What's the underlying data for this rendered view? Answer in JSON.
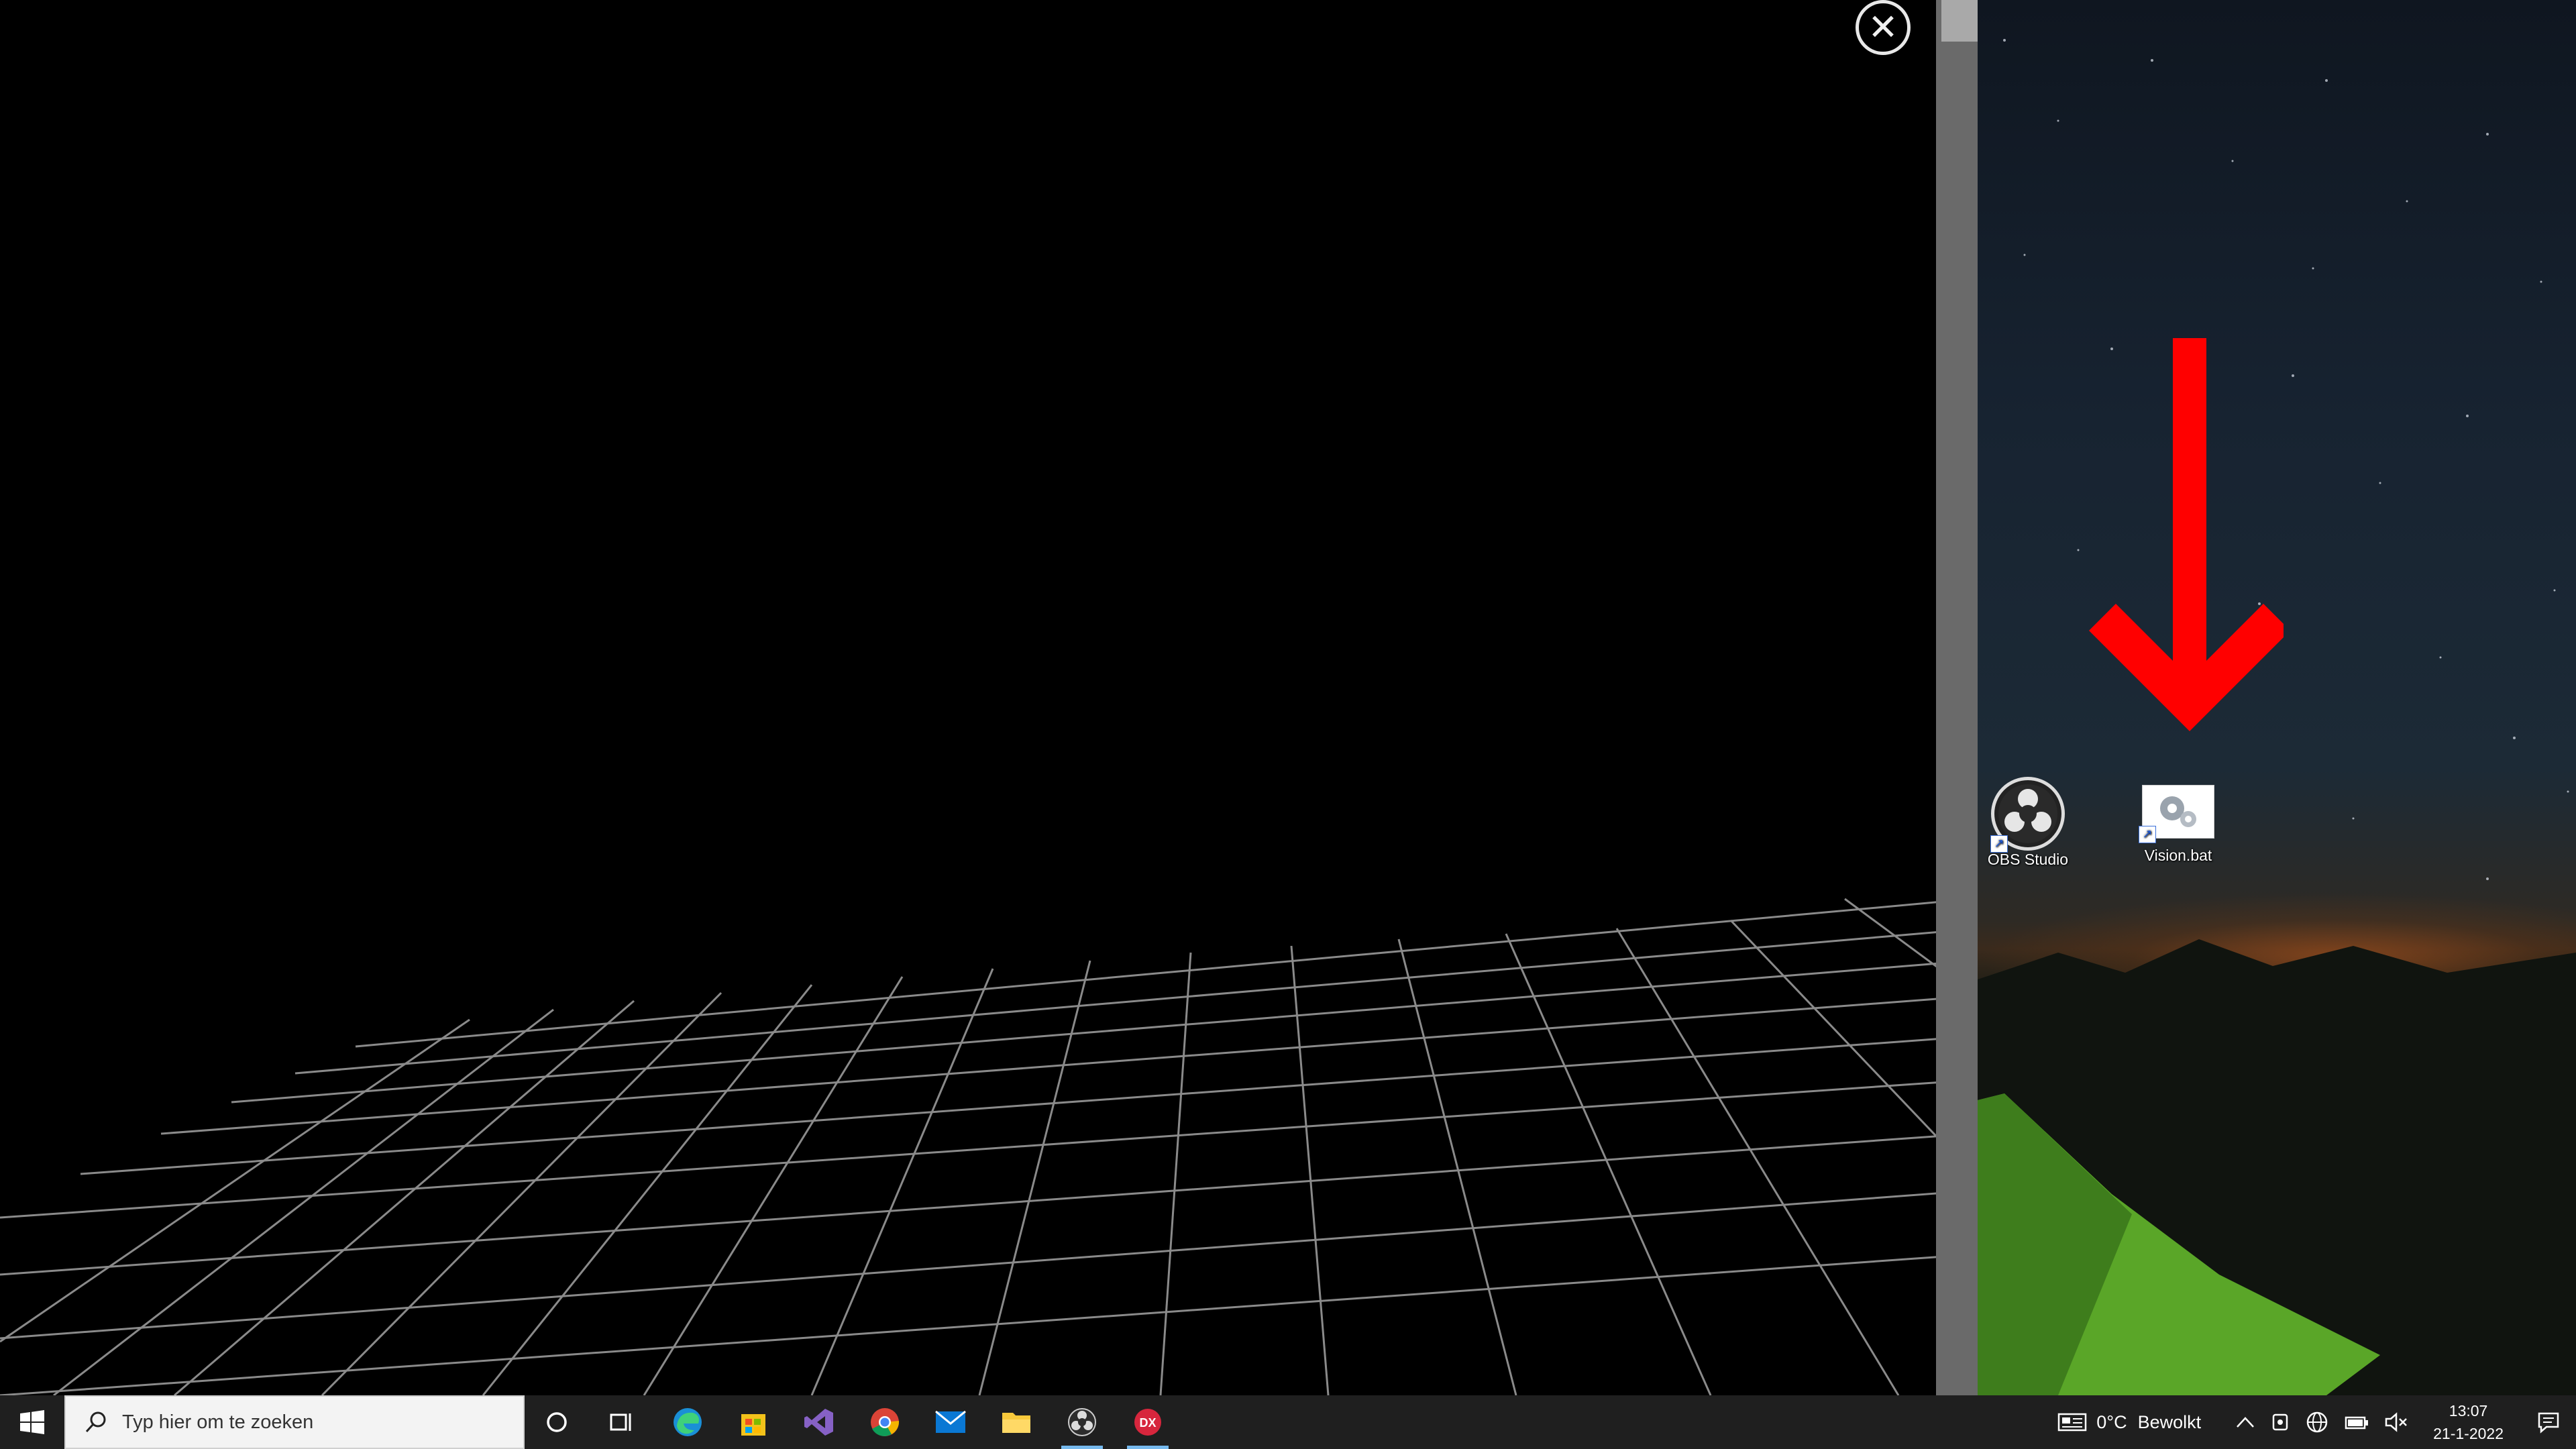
{
  "viewer": {
    "close_label": "✕"
  },
  "desktop": {
    "icons": [
      {
        "label": "OBS Studio",
        "icon": "obs-studio-icon"
      },
      {
        "label": "Vision.bat",
        "icon": "batch-file-gears-icon"
      }
    ],
    "annotation_color": "#ff0000"
  },
  "taskbar": {
    "search_placeholder": "Typ hier om te zoeken",
    "apps": [
      {
        "name": "cortana",
        "icon": "circle-icon"
      },
      {
        "name": "task-view",
        "icon": "task-view-icon"
      },
      {
        "name": "edge",
        "icon": "edge-icon"
      },
      {
        "name": "store",
        "icon": "store-icon"
      },
      {
        "name": "visual-studio",
        "icon": "visual-studio-icon"
      },
      {
        "name": "chrome",
        "icon": "chrome-icon"
      },
      {
        "name": "mail",
        "icon": "mail-icon"
      },
      {
        "name": "file-explorer",
        "icon": "folder-icon"
      },
      {
        "name": "obs",
        "icon": "obs-icon"
      },
      {
        "name": "dx-app",
        "icon": "dx-icon"
      }
    ],
    "weather": {
      "temp": "0°C",
      "condition": "Bewolkt"
    },
    "clock": {
      "time": "13:07",
      "date": "21-1-2022"
    },
    "accent": "#76b9ed"
  }
}
